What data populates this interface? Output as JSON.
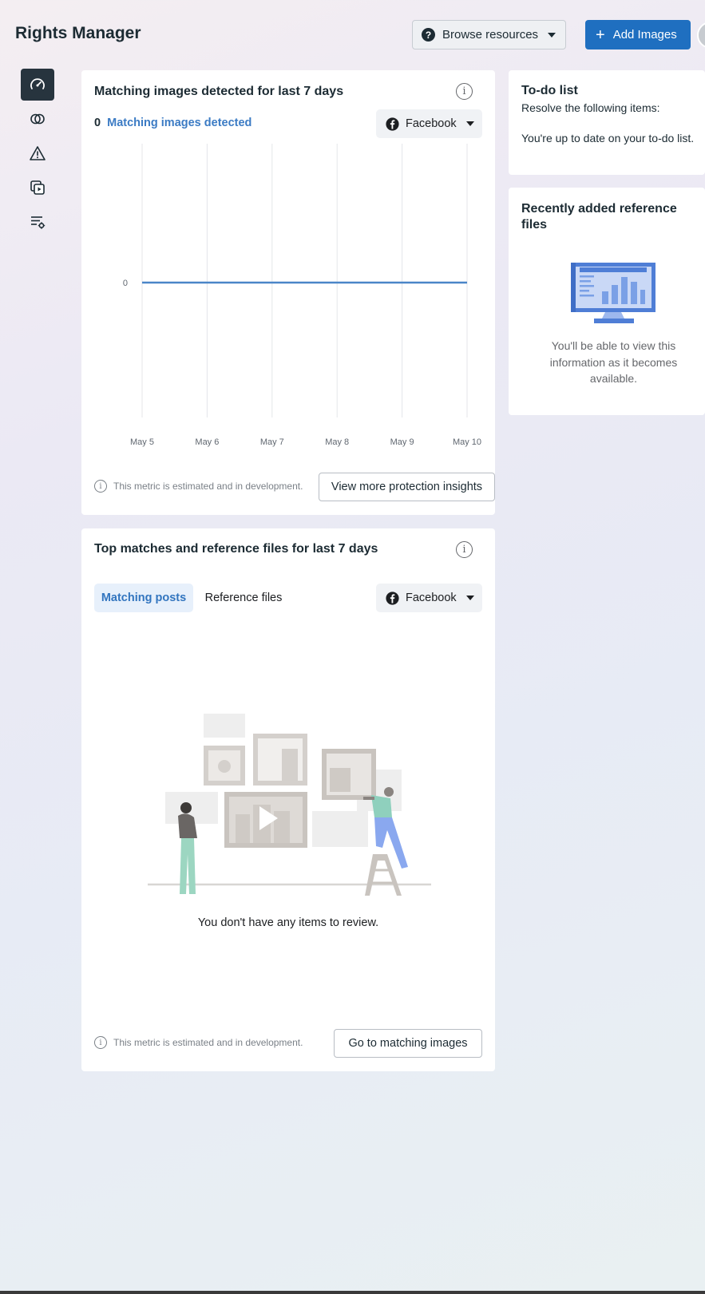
{
  "header": {
    "title": "Rights Manager",
    "browse_label": "Browse resources",
    "add_label": "Add Images"
  },
  "sidebar": {
    "items": [
      {
        "icon": "dashboard-gauge-icon",
        "active": true
      },
      {
        "icon": "overlap-circles-icon",
        "active": false
      },
      {
        "icon": "warning-triangle-icon",
        "active": false
      },
      {
        "icon": "media-library-icon",
        "active": false
      },
      {
        "icon": "settings-list-icon",
        "active": false
      }
    ]
  },
  "matching_card": {
    "title": "Matching images detected for last 7 days",
    "count": "0",
    "link_label": "Matching images detected",
    "platform": "Facebook",
    "footnote": "This metric is estimated and in development.",
    "action_label": "View more protection insights"
  },
  "chart_data": {
    "type": "line",
    "x": [
      "May 5",
      "May 6",
      "May 7",
      "May 8",
      "May 9",
      "May 10"
    ],
    "series": [
      {
        "values": [
          0,
          0,
          0,
          0,
          0,
          0
        ]
      }
    ],
    "y_ticks": [
      "0"
    ],
    "grid": "vertical",
    "colors": {
      "line": "#4a86c8",
      "grid": "#e4e6ea"
    }
  },
  "top_matches_card": {
    "title": "Top matches and reference files for last 7 days",
    "tabs": [
      {
        "label": "Matching posts",
        "active": true
      },
      {
        "label": "Reference files",
        "active": false
      }
    ],
    "platform": "Facebook",
    "empty_message": "You don't have any items to review.",
    "footnote": "This metric is estimated and in development.",
    "action_label": "Go to matching images"
  },
  "todo": {
    "title": "To-do list",
    "subtitle": "Resolve the following items:",
    "message": "You're up to date on your to-do list."
  },
  "recent_refs": {
    "title": "Recently added reference files",
    "message": "You'll be able to view this information as it becomes available."
  },
  "colors": {
    "primary": "#1f6fc0",
    "link": "#3b7bc4",
    "nav_active": "#27343e"
  }
}
